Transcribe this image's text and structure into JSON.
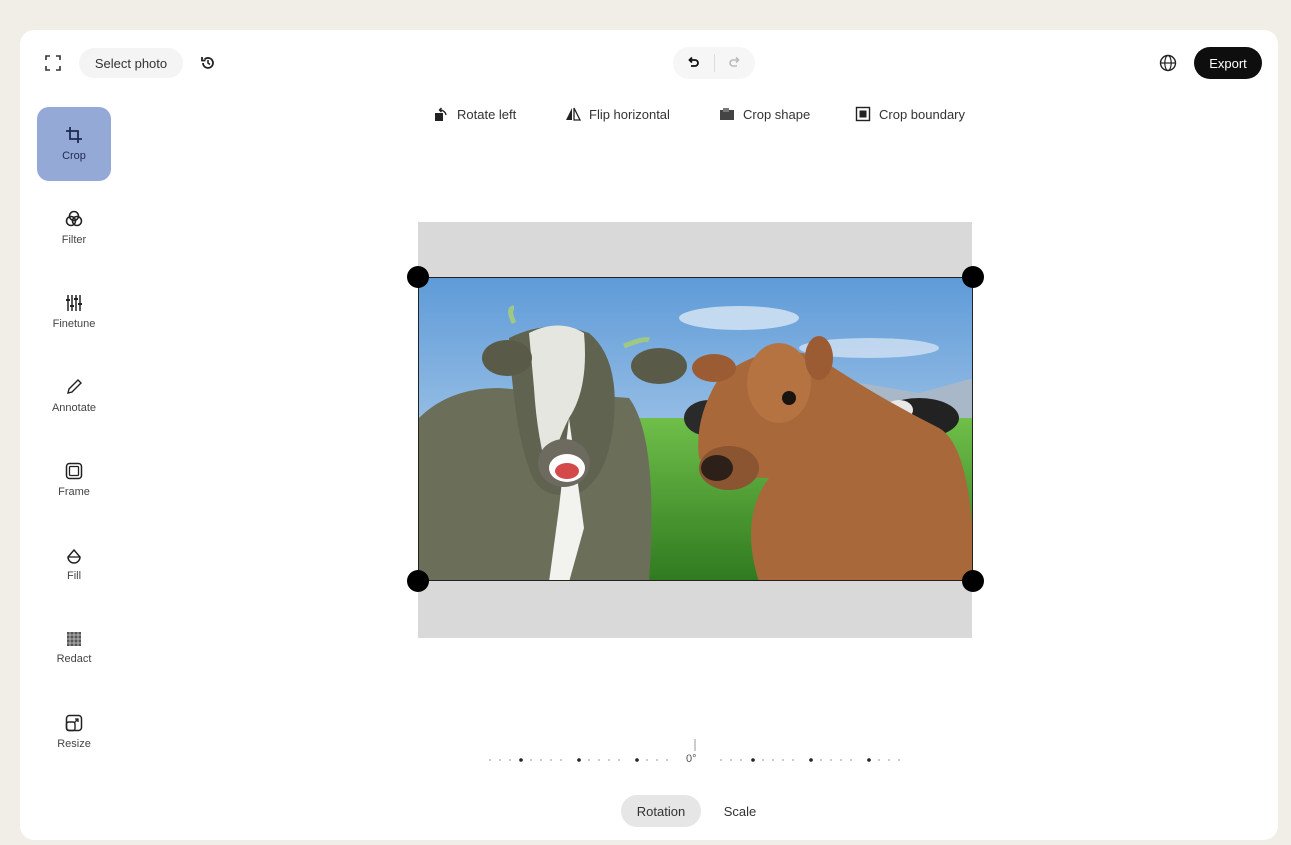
{
  "topbar": {
    "fullscreen_icon": "fullscreen-icon",
    "select_photo_label": "Select photo",
    "history_icon": "history-icon",
    "undo_icon": "undo-icon",
    "redo_icon": "redo-icon",
    "language_icon": "globe-icon",
    "export_label": "Export"
  },
  "crop_tools": [
    {
      "label": "Rotate left",
      "icon": "rotate-left-icon"
    },
    {
      "label": "Flip horizontal",
      "icon": "flip-horizontal-icon"
    },
    {
      "label": "Crop shape",
      "icon": "crop-shape-icon"
    },
    {
      "label": "Crop boundary",
      "icon": "crop-boundary-icon"
    }
  ],
  "sidebar": {
    "items": [
      {
        "label": "Crop",
        "icon": "crop-icon",
        "active": true
      },
      {
        "label": "Filter",
        "icon": "filter-icon"
      },
      {
        "label": "Finetune",
        "icon": "finetune-icon"
      },
      {
        "label": "Annotate",
        "icon": "pencil-icon"
      },
      {
        "label": "Frame",
        "icon": "frame-icon"
      },
      {
        "label": "Fill",
        "icon": "fill-icon"
      },
      {
        "label": "Redact",
        "icon": "redact-icon"
      },
      {
        "label": "Resize",
        "icon": "resize-icon"
      }
    ]
  },
  "rotation": {
    "value_label": "0°"
  },
  "bottom_tabs": {
    "rotation_label": "Rotation",
    "scale_label": "Scale"
  },
  "colors": {
    "active_tool": "#95a9d6",
    "export_bg": "#0e0e0e",
    "boundary": "#d9d9d9"
  }
}
